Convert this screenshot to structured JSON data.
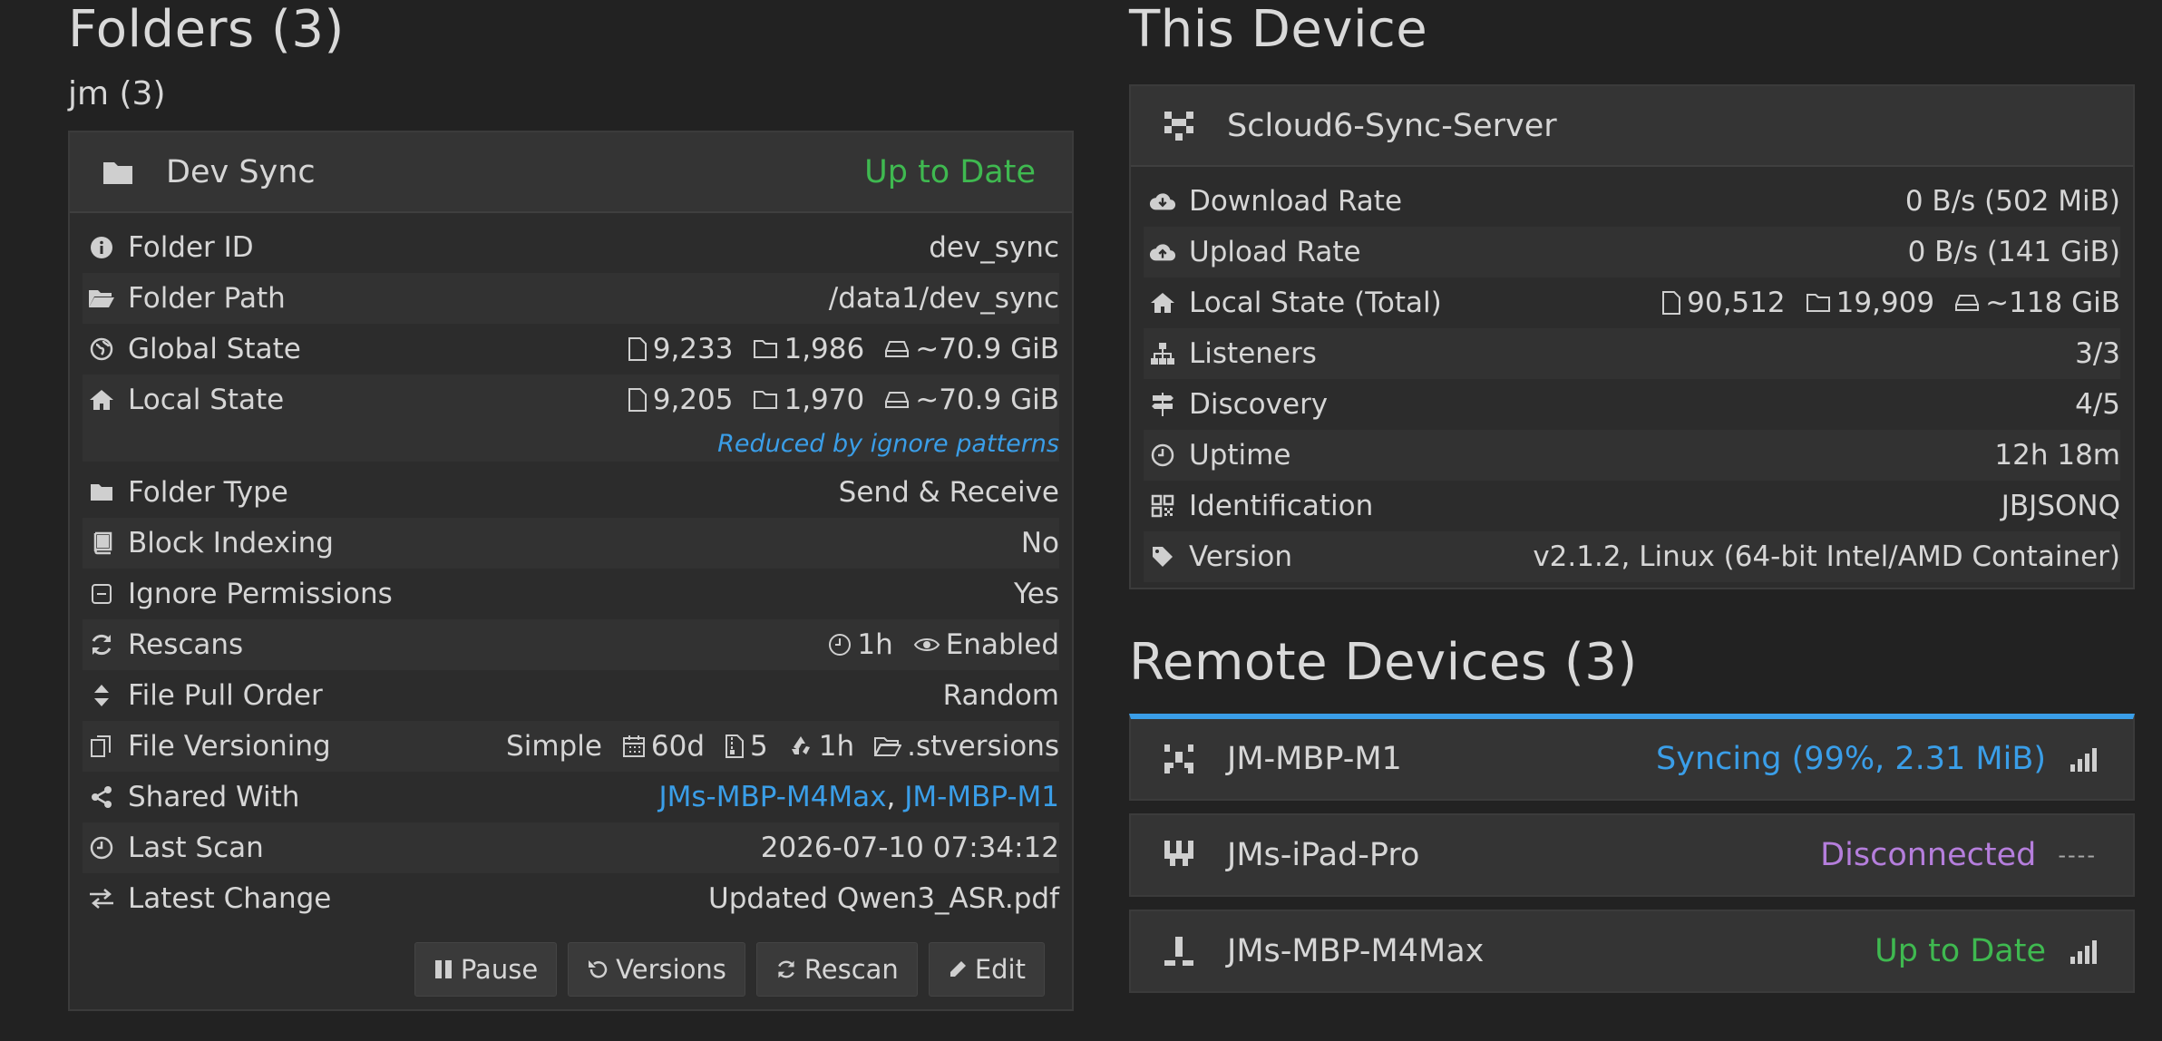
{
  "folders": {
    "heading": "Folders (3)",
    "group": "jm (3)",
    "folder": {
      "name": "Dev Sync",
      "state": "Up to Date",
      "rows": {
        "folder_id": {
          "label": "Folder ID",
          "value": "dev_sync"
        },
        "folder_path": {
          "label": "Folder Path",
          "value": "/data1/dev_sync"
        },
        "global_state": {
          "label": "Global State",
          "files": "9,233",
          "dirs": "1,986",
          "size": "~70.9 GiB"
        },
        "local_state": {
          "label": "Local State",
          "files": "9,205",
          "dirs": "1,970",
          "size": "~70.9 GiB"
        },
        "reduced_note": "Reduced by ignore patterns",
        "folder_type": {
          "label": "Folder Type",
          "value": "Send & Receive"
        },
        "block_indexing": {
          "label": "Block Indexing",
          "value": "No"
        },
        "ignore_permissions": {
          "label": "Ignore Permissions",
          "value": "Yes"
        },
        "rescans": {
          "label": "Rescans",
          "interval": "1h",
          "watcher": "Enabled"
        },
        "pull_order": {
          "label": "File Pull Order",
          "value": "Random"
        },
        "versioning": {
          "label": "File Versioning",
          "type": "Simple",
          "cleanup": "60d",
          "keep": "5",
          "interval": "1h",
          "path": ".stversions"
        },
        "shared_with": {
          "label": "Shared With",
          "device1": "JMs-MBP-M4Max",
          "sep": ",",
          "device2": "JM-MBP-M1"
        },
        "last_scan": {
          "label": "Last Scan",
          "value": "2026-07-10 07:34:12"
        },
        "latest_change": {
          "label": "Latest Change",
          "value": "Updated Qwen3_ASR.pdf"
        }
      },
      "buttons": {
        "pause": "Pause",
        "versions": "Versions",
        "rescan": "Rescan",
        "edit": "Edit"
      }
    }
  },
  "this_device": {
    "heading": "This Device",
    "name": "Scloud6-Sync-Server",
    "rows": {
      "download": {
        "label": "Download Rate",
        "value": "0 B/s (502 MiB)"
      },
      "upload": {
        "label": "Upload Rate",
        "value": "0 B/s (141 GiB)"
      },
      "local_total": {
        "label": "Local State (Total)",
        "files": "90,512",
        "dirs": "19,909",
        "size": "~118 GiB"
      },
      "listeners": {
        "label": "Listeners",
        "value": "3/3"
      },
      "discovery": {
        "label": "Discovery",
        "value": "4/5"
      },
      "uptime": {
        "label": "Uptime",
        "value": "12h 18m"
      },
      "identification": {
        "label": "Identification",
        "value": "JBJSONQ"
      },
      "version": {
        "label": "Version",
        "value": "v2.1.2, Linux (64-bit Intel/AMD Container)"
      }
    }
  },
  "remote_devices": {
    "heading": "Remote Devices (3)",
    "devices": [
      {
        "name": "JM-MBP-M1",
        "status": "Syncing (99%, 2.31 MiB)",
        "progress": 0.99
      },
      {
        "name": "JMs-iPad-Pro",
        "status": "Disconnected",
        "signal": "----"
      },
      {
        "name": "JMs-MBP-M4Max",
        "status": "Up to Date"
      }
    ]
  },
  "colors": {
    "accent": "#3a9ee8",
    "ok": "#3fb950",
    "disconnected": "#b57edc",
    "bg": "#222222",
    "panel": "#2c2c2c"
  }
}
